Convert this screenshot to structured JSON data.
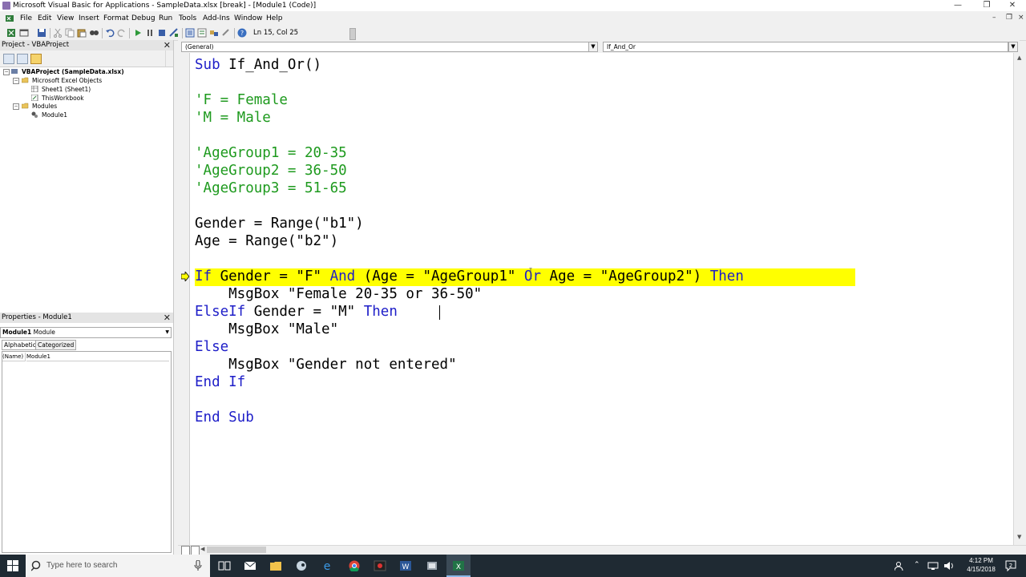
{
  "window": {
    "title": "Microsoft Visual Basic for Applications - SampleData.xlsx [break] - [Module1 (Code)]",
    "min_glyph": "—",
    "max_glyph": "❐",
    "close_glyph": "✕"
  },
  "menu": {
    "items": [
      "File",
      "Edit",
      "View",
      "Insert",
      "Format",
      "Debug",
      "Run",
      "Tools",
      "Add-Ins",
      "Window",
      "Help"
    ],
    "mdi_min": "–",
    "mdi_restore": "❐",
    "mdi_close": "×"
  },
  "toolbar": {
    "position": "Ln 15, Col 25"
  },
  "project": {
    "title": "Project - VBAProject",
    "close_glyph": "✕",
    "tree": [
      {
        "label": "VBAProject (SampleData.xlsx)",
        "toggle": "−"
      },
      {
        "label": "Microsoft Excel Objects",
        "toggle": "−"
      },
      {
        "label": "Sheet1 (Sheet1)"
      },
      {
        "label": "ThisWorkbook"
      },
      {
        "label": "Modules",
        "toggle": "−"
      },
      {
        "label": "Module1"
      }
    ]
  },
  "properties": {
    "title": "Properties - Module1",
    "close_glyph": "✕",
    "object_name": "Module1",
    "object_type": "Module",
    "tabs": [
      "Alphabetic",
      "Categorized"
    ],
    "row_name": "(Name)",
    "row_value": "Module1"
  },
  "code": {
    "object_combo": "(General)",
    "proc_combo": "If_And_Or",
    "lines": {
      "l1_kw": "Sub",
      "l1_rest": " If_And_Or()",
      "c1": "'F = Female",
      "c2": "'M = Male",
      "c3": "'AgeGroup1 = 20-35",
      "c4": "'AgeGroup2 = 36-50",
      "c5": "'AgeGroup3 = 51-65",
      "g1": "Gender = Range(\"b1\")",
      "g2": "Age = Range(\"b2\")",
      "if_kw1": "If",
      "if_mid1": " Gender = \"F\" ",
      "if_kw2": "And",
      "if_mid2": " (Age = \"AgeGroup1\" ",
      "if_kw3": "Or",
      "if_mid3": " Age = \"AgeGroup2\") ",
      "if_kw4": "Then",
      "msg1": "    MsgBox \"Female 20-35 or 36-50\"",
      "elseif_kw": "ElseIf",
      "elseif_mid": " Gender = \"M\" ",
      "elseif_then": "Then",
      "msg2": "    MsgBox \"Male\"",
      "else_kw": "Else",
      "msg3": "    MsgBox \"Gender not entered\"",
      "endif_kw": "End If",
      "endsub_kw": "End Sub"
    }
  },
  "taskbar": {
    "search_placeholder": "Type here to search",
    "time": "4:12 PM",
    "date": "4/15/2018",
    "notification_count": "2"
  },
  "colors": {
    "keyword": "#1e1ec8",
    "comment": "#1e9a1e",
    "exec_highlight": "#ffff00",
    "taskbar": "#1f2a33"
  }
}
